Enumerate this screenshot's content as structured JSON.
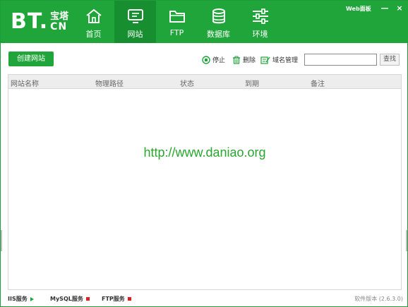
{
  "header": {
    "logo_main": "BT.",
    "logo_cn": "宝塔",
    "logo_domain": "CN",
    "window_title": "Web面板",
    "minimize_label": "—",
    "close_label": "×"
  },
  "nav": [
    {
      "label": "首页",
      "icon": "home-icon"
    },
    {
      "label": "网站",
      "icon": "monitor-icon",
      "active": true
    },
    {
      "label": "FTP",
      "icon": "folder-icon"
    },
    {
      "label": "数据库",
      "icon": "database-icon"
    },
    {
      "label": "环境",
      "icon": "sliders-icon"
    }
  ],
  "toolbar": {
    "create_label": "创建网站",
    "stop_label": "停止",
    "delete_label": "删除",
    "domain_label": "域名管理",
    "search_value": "",
    "search_button": "查找"
  },
  "table": {
    "columns": [
      "网站名称",
      "物理路径",
      "状态",
      "到期",
      "备注"
    ],
    "rows": []
  },
  "watermark": "http://www.daniao.org",
  "statusbar": {
    "services": [
      {
        "label": "IIS服务",
        "state": "running"
      },
      {
        "label": "MySQL服务",
        "state": "stopped"
      },
      {
        "label": "FTP服务",
        "state": "stopped"
      }
    ],
    "version": "软件版本 (2.6.3.0)"
  },
  "colors": {
    "brand_green": "#20a53a",
    "active_nav": "#178f30",
    "stopped_red": "#e02020"
  }
}
